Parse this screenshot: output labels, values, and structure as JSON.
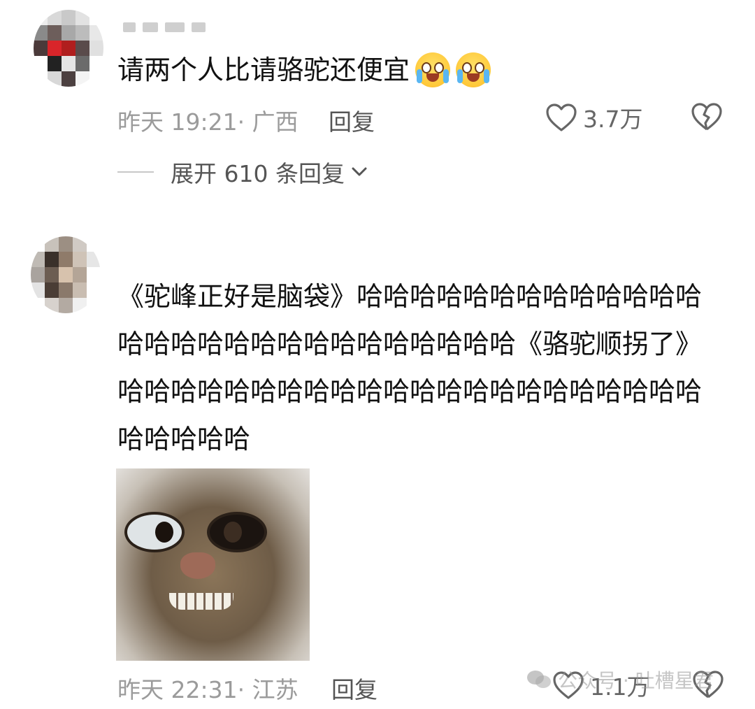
{
  "comments": [
    {
      "text": "请两个人比请骆驼还便宜",
      "emoji_icon": "crying-laughing-emoji",
      "emoji_count": 2,
      "time": "昨天 19:21",
      "location": "广西",
      "meta": "昨天 19:21· 广西",
      "reply_label": "回复",
      "like_count": "3.7万",
      "expand_label": "展开 610 条回复"
    },
    {
      "text": "《驼峰正好是脑袋》哈哈哈哈哈哈哈哈哈哈哈哈哈哈哈哈哈哈哈哈哈哈哈哈哈哈哈哈《骆驼顺拐了》哈哈哈哈哈哈哈哈哈哈哈哈哈哈哈哈哈哈哈哈哈哈哈哈哈哈哈",
      "image_icon": "cat-meme-image",
      "meta": "昨天 22:31· 江苏",
      "reply_label": "回复",
      "like_count": "1.1万"
    }
  ],
  "watermark": {
    "text": "公众号 · 吐槽星君",
    "icon": "wechat-icon"
  },
  "colors": {
    "meta_text": "#9b9b9b",
    "body_text": "#111111",
    "action_text": "#555555"
  }
}
